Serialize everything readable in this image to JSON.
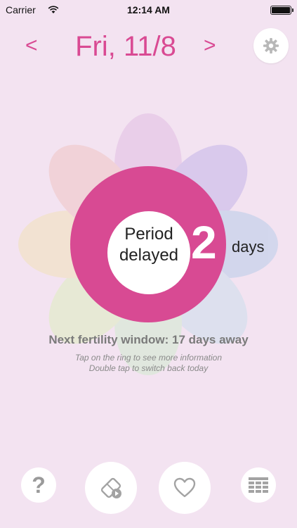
{
  "status_bar": {
    "carrier": "Carrier",
    "time": "12:14 AM",
    "wifi_icon": "wifi-icon",
    "battery_icon": "battery-full-icon"
  },
  "header": {
    "prev_label": "<",
    "date": "Fri, 11/8",
    "next_label": ">",
    "settings_icon": "gear-icon"
  },
  "ring": {
    "status_line1": "Period",
    "status_line2": "delayed",
    "count": "2",
    "unit": "days",
    "ring_color": "#d84a93",
    "petal_colors": [
      "#e9cce9",
      "#d7c7ec",
      "#cfd5ec",
      "#dbe0ee",
      "#dfe8dc",
      "#e6ead3",
      "#f2e2cf",
      "#f1d1d6"
    ]
  },
  "info": {
    "next_fertility": "Next fertility window: 17 days away",
    "hint1": "Tap on the ring to see more information",
    "hint2": "Double tap to switch back today"
  },
  "toolbar": {
    "help_label": "?",
    "help_icon": "question-mark-icon",
    "log_icon": "edit-pencil-icon",
    "love_icon": "heart-icon",
    "calendar_icon": "calendar-grid-icon"
  },
  "colors": {
    "background": "#f3e3f1",
    "accent": "#d94a93",
    "text_gray": "#7a7a7a"
  }
}
